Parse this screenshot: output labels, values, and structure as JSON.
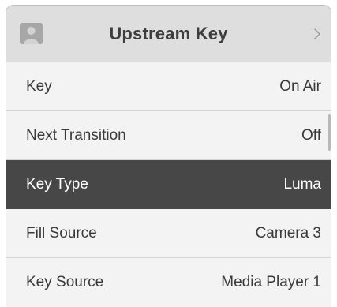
{
  "header": {
    "title": "Upstream Key",
    "avatar_icon": "person-icon",
    "chevron_icon": "chevron-right-icon"
  },
  "menu": {
    "rows": [
      {
        "label": "Key",
        "value": "On Air",
        "selected": false
      },
      {
        "label": "Next Transition",
        "value": "Off",
        "selected": false
      },
      {
        "label": "Key Type",
        "value": "Luma",
        "selected": true
      },
      {
        "label": "Fill Source",
        "value": "Camera 3",
        "selected": false
      },
      {
        "label": "Key Source",
        "value": "Media Player 1",
        "selected": false
      }
    ]
  },
  "colors": {
    "header_background": "#dedede",
    "row_background": "#f3f3f3",
    "selected_background": "#474747",
    "text": "#3a3a3a",
    "selected_text": "#ffffff"
  }
}
